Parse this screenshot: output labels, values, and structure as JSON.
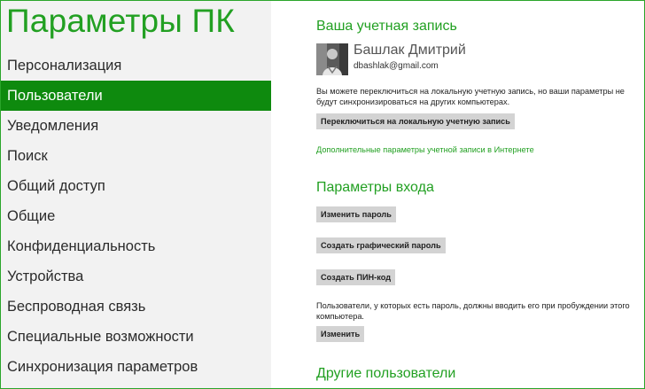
{
  "app": {
    "title": "Параметры ПК"
  },
  "sidebar": {
    "items": [
      {
        "label": "Персонализация",
        "active": false
      },
      {
        "label": "Пользователи",
        "active": true
      },
      {
        "label": "Уведомления",
        "active": false
      },
      {
        "label": "Поиск",
        "active": false
      },
      {
        "label": "Общий доступ",
        "active": false
      },
      {
        "label": "Общие",
        "active": false
      },
      {
        "label": "Конфиденциальность",
        "active": false
      },
      {
        "label": "Устройства",
        "active": false
      },
      {
        "label": "Беспроводная связь",
        "active": false
      },
      {
        "label": "Специальные возможности",
        "active": false
      },
      {
        "label": "Синхронизация параметров",
        "active": false
      }
    ]
  },
  "account": {
    "section_title": "Ваша учетная запись",
    "user_name": "Башлак Дмитрий",
    "user_email": "dbashlak@gmail.com",
    "description": "Вы можете переключиться на локальную учетную запись, но ваши параметры не будут синхронизироваться на других компьютерах.",
    "switch_button": "Переключиться на локальную учетную запись",
    "more_link": "Дополнительные параметры учетной записи в Интернете"
  },
  "signin": {
    "section_title": "Параметры входа",
    "change_password_button": "Изменить пароль",
    "picture_password_button": "Создать графический пароль",
    "pin_button": "Создать ПИН-код",
    "wake_description": "Пользователи, у которых есть пароль, должны вводить его при пробуждении этого компьютера.",
    "change_button": "Изменить"
  },
  "other_users": {
    "section_title": "Другие пользователи"
  },
  "colors": {
    "accent": "#22a022",
    "active_nav": "#0e8a0e",
    "sidebar_bg": "#f2f2f2",
    "button_bg": "#d3d3d3"
  }
}
